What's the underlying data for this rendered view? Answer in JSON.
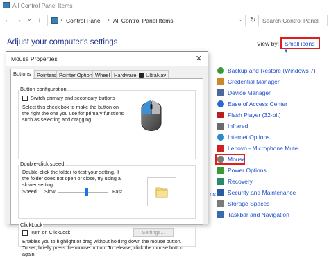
{
  "window": {
    "title": "All Control Panel Items"
  },
  "addressbar": {
    "back": "←",
    "forward": "→",
    "dropdown": "⌄",
    "up": "↑",
    "crumbs": [
      "Control Panel",
      "All Control Panel Items"
    ],
    "separator": "›",
    "search_placeholder": "Search Control Panel"
  },
  "page": {
    "heading": "Adjust your computer's settings",
    "view_by_label": "View by:",
    "view_by_value": "Small icons ▾"
  },
  "items": [
    {
      "label": "Backup and Restore (Windows 7)",
      "color": "#3a9a3a"
    },
    {
      "label": "Credential Manager",
      "color": "#c88a2a"
    },
    {
      "label": "Device Manager",
      "color": "#4a6a9a"
    },
    {
      "label": "Ease of Access Center",
      "color": "#2a6acc"
    },
    {
      "label": "Flash Player (32-bit)",
      "color": "#b52020"
    },
    {
      "label": "Infrared",
      "color": "#6a6a6a"
    },
    {
      "label": "Internet Options",
      "color": "#2a8acc"
    },
    {
      "label": "Lenovo - Microphone Mute",
      "color": "#d02020"
    },
    {
      "label": "Mouse",
      "color": "#7a7a7a"
    },
    {
      "label": "Power Options",
      "color": "#3a9a3a"
    },
    {
      "label": "Recovery",
      "color": "#2a8a6a"
    },
    {
      "label": "Security and Maintenance",
      "color": "#2a5aa0"
    },
    {
      "label": "Storage Spaces",
      "color": "#7a7a7a"
    },
    {
      "label": "Taskbar and Navigation",
      "color": "#3a6aaa"
    }
  ],
  "left_edge_fragment": "ns",
  "dialog": {
    "title": "Mouse Properties",
    "close": "✕",
    "tabs": [
      "Buttons",
      "Pointers",
      "Pointer Options",
      "Wheel",
      "Hardware",
      "UltraNav"
    ],
    "button_config": {
      "label": "Button configuration",
      "checkbox_label": "Switch primary and secondary buttons",
      "description": "Select this check box to make the button on the right the one you use for primary functions such as selecting and dragging."
    },
    "double_click": {
      "label": "Double-click speed",
      "description": "Double-click the folder to test your setting. If the folder does not open or close, try using a slower setting.",
      "speed_label": "Speed:",
      "slow": "Slow",
      "fast": "Fast",
      "speed_fraction": 0.55
    },
    "clicklock": {
      "label": "ClickLock",
      "checkbox_label": "Turn on ClickLock",
      "settings_button": "Settings...",
      "description": "Enables you to highlight or drag without holding down the mouse button. To set, briefly press the mouse button. To release, click the mouse button again."
    }
  }
}
